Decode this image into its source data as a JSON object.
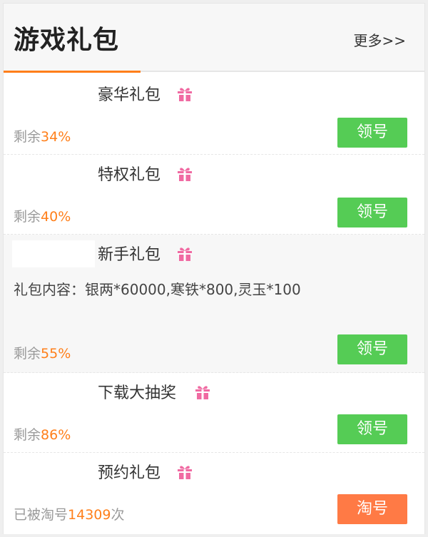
{
  "header": {
    "title": "游戏礼包",
    "more": "更多>>"
  },
  "colors": {
    "accent": "#ff7f1a",
    "claim": "#55cc55",
    "tao": "#ff7a45",
    "gift_icon": "#f06aa2"
  },
  "gifts": [
    {
      "name": "豪华礼包",
      "gift_icon": "gift-icon",
      "remain_prefix": "剩余",
      "remain_value": "34%",
      "remain_suffix": "",
      "button": "领号"
    },
    {
      "name": "特权礼包",
      "gift_icon": "gift-icon",
      "remain_prefix": "剩余",
      "remain_value": "40%",
      "remain_suffix": "",
      "button": "领号"
    },
    {
      "name": "新手礼包",
      "gift_icon": "gift-icon",
      "content": "礼包内容：银两*60000,寒铁*800,灵玉*100",
      "remain_prefix": "剩余",
      "remain_value": "55%",
      "remain_suffix": "",
      "button": "领号"
    },
    {
      "name": "下载大抽奖",
      "gift_icon": "gift-icon",
      "remain_prefix": "剩余",
      "remain_value": "86%",
      "remain_suffix": "",
      "button": "领号"
    },
    {
      "name": "预约礼包",
      "gift_icon": "gift-icon",
      "remain_prefix": "已被淘号",
      "remain_value": "14309",
      "remain_suffix": "次",
      "button": "淘号"
    }
  ]
}
